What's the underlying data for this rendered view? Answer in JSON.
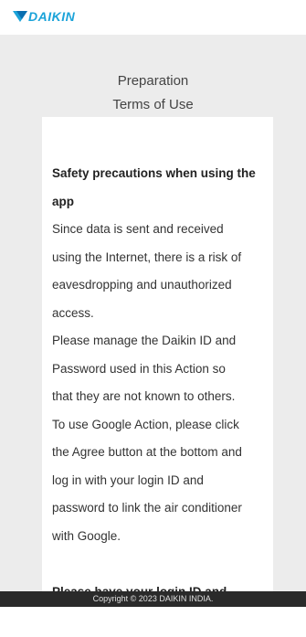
{
  "header": {
    "logo_text": "DAIKIN",
    "logo_color": "#1ba3d9"
  },
  "headings": {
    "preparation": "Preparation",
    "terms": "Terms of Use"
  },
  "terms": {
    "title_lines": [
      "Safety precautions when using the",
      "app"
    ],
    "body_lines": [
      "Since data is sent and received",
      "using the Internet, there is a risk of",
      "eavesdropping and unauthorized",
      "access.",
      "Please manage the Daikin ID and",
      "Password used in this Action so",
      "that they are not known to others.",
      "To use Google Action, please click",
      "the Agree button at the bottom and",
      "log in with your login ID and",
      "password to link the air conditioner",
      "with Google."
    ],
    "next_title": "Please have your login ID and"
  },
  "footer": {
    "copyright": "Copyright © 2023 DAIKIN INDIA."
  },
  "colors": {
    "page_background": "#ececec",
    "card_background": "#ffffff",
    "footer_background": "#2a2a2a"
  }
}
